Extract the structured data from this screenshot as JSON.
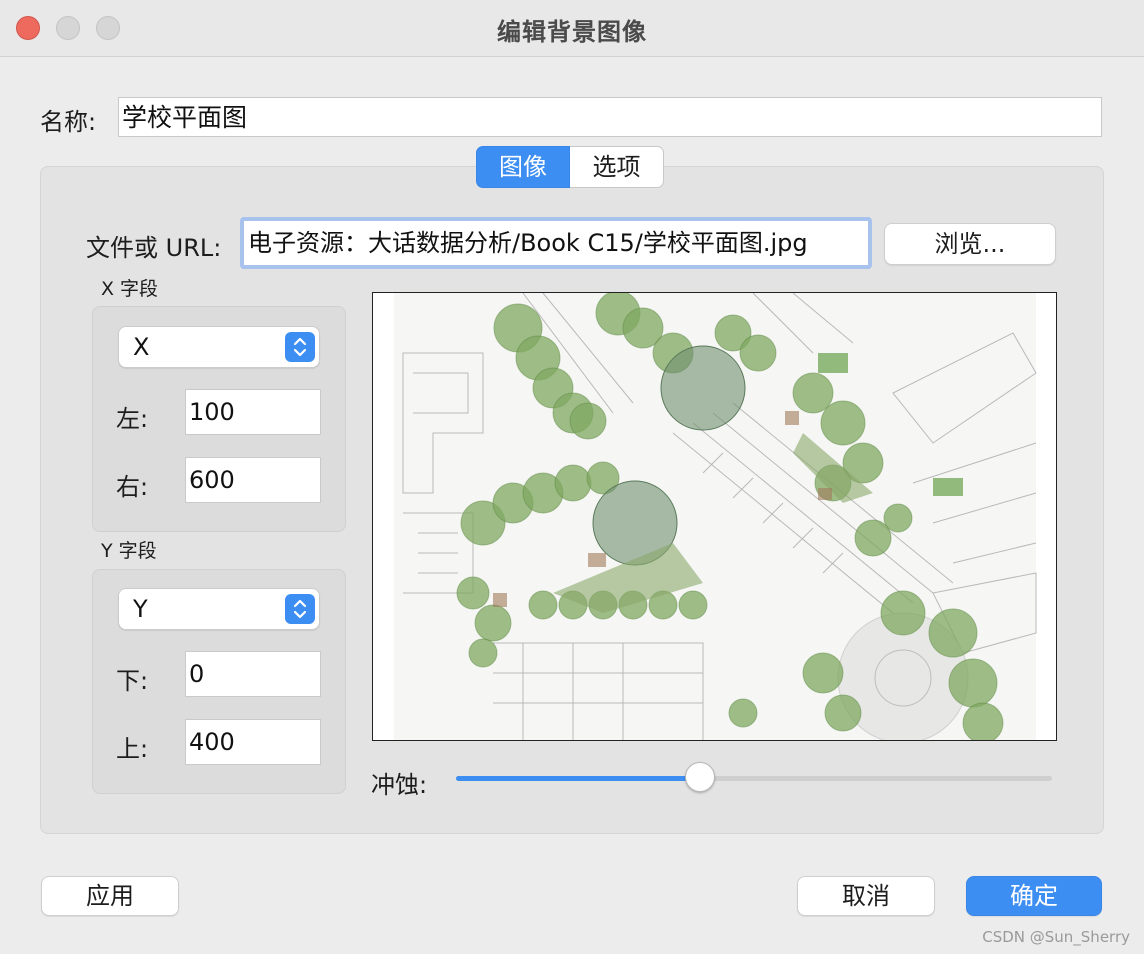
{
  "window": {
    "title": "编辑背景图像"
  },
  "name_row": {
    "label": "名称:",
    "value": "学校平面图"
  },
  "tabs": [
    {
      "label": "图像",
      "active": true
    },
    {
      "label": "选项",
      "active": false
    }
  ],
  "file": {
    "label": "文件或 URL:",
    "value": "电子资源：大话数据分析/Book C15/学校平面图.jpg",
    "browse_label": "浏览..."
  },
  "x_field": {
    "group_title": "X 字段",
    "selected": "X",
    "left_label": "左:",
    "left_value": "100",
    "right_label": "右:",
    "right_value": "600"
  },
  "y_field": {
    "group_title": "Y 字段",
    "selected": "Y",
    "bottom_label": "下:",
    "bottom_value": "0",
    "top_label": "上:",
    "top_value": "400"
  },
  "preview": {
    "image": "school-site-plan"
  },
  "wash": {
    "label": "冲蚀:",
    "value": 0.41
  },
  "buttons": {
    "apply": "应用",
    "cancel": "取消",
    "ok": "确定"
  },
  "watermark": "CSDN @Sun_Sherry",
  "colors": {
    "accent": "#3d8ef2",
    "close": "#ee6a5f",
    "tree": "#7fa860"
  }
}
